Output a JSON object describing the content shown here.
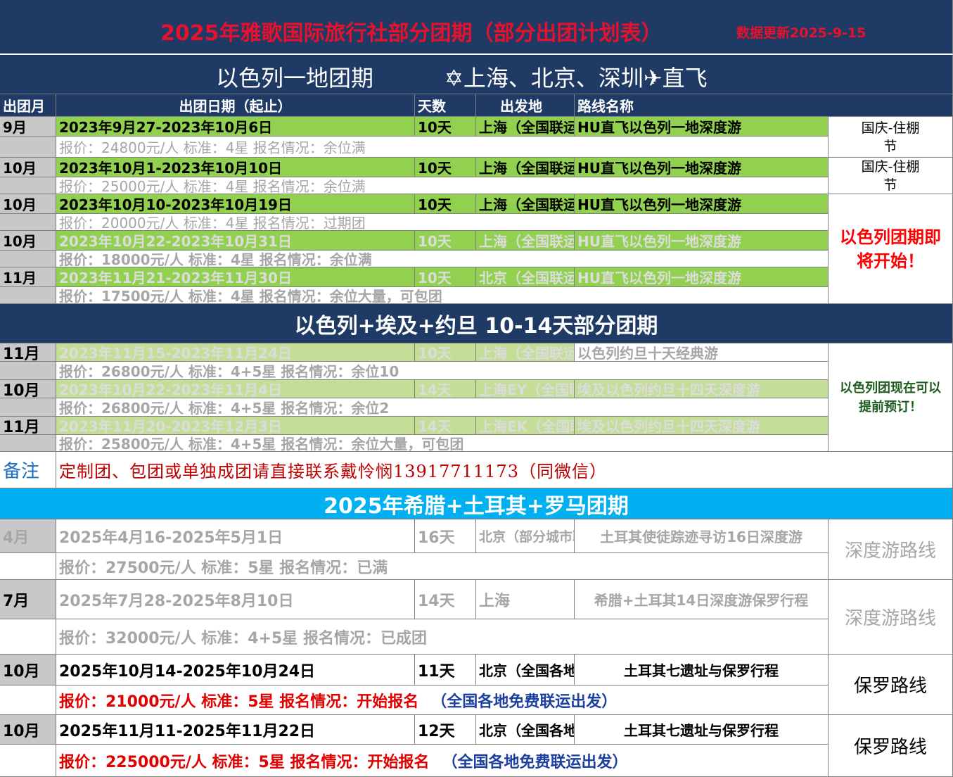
{
  "title": {
    "main": "2025年雅歌国际旅行社部分团期（部分出团计划表）",
    "updated": "数据更新2025-9-15"
  },
  "section1": {
    "title": "以色列一地团期",
    "route": "✡上海、北京、深圳✈直飞"
  },
  "headers": {
    "month": "出团月",
    "dates": "出团日期（起止）",
    "days": "天数",
    "from": "出发地",
    "route": "路线名称"
  },
  "israel_rows": [
    {
      "month": "9月",
      "dates": "2023年9月27-2023年10月6日",
      "days": "10天",
      "from": "上海（全国联运）",
      "route": "HU直飞以色列一地深度游",
      "price": "报价：24800元/人  标准：4星   报名情况：余位满"
    },
    {
      "month": "10月",
      "dates": "2023年10月1-2023年10月10日",
      "days": "10天",
      "from": "上海（全国联运）",
      "route": "HU直飞以色列一地深度游",
      "price": "报价：25000元/人  标准：4星   报名情况：余位满"
    },
    {
      "month": "10月",
      "dates": "2023年10月10-2023年10月19日",
      "days": "10天",
      "from": "上海（全国联运）",
      "route": "HU直飞以色列一地深度游",
      "price": "报价：20000元/人  标准：4星   报名情况：过期团"
    },
    {
      "month": "10月",
      "dates": "2023年10月22-2023年10月31日",
      "days": "10天",
      "from": "上海（全国联运）",
      "route": "HU直飞以色列一地深度游",
      "price": "报价：18000元/人  标准：4星   报名情况：余位满"
    },
    {
      "month": "11月",
      "dates": "2023年11月21-2023年11月30日",
      "days": "10天",
      "from": "北京（全国联运）",
      "route": "HU直飞以色列一地深度游",
      "price": "报价：17500元/人  标准：4星   报名情况：余位大量，可包团"
    }
  ],
  "israel_notes": {
    "note1": "国庆-住棚节",
    "note2": "国庆-住棚节",
    "note3": "以色列团期即将开始！"
  },
  "section2": {
    "title": "以色列+埃及+约旦 10-14天部分团期"
  },
  "combo_rows": [
    {
      "month": "11月",
      "dates": "2023年11月15-2023年11月24日",
      "days": "10天",
      "from": "上海（全国联运）",
      "route": "以色列约旦十天经典游",
      "price": "报价：26800元/人  标准：4+5星   报名情况：余位10"
    },
    {
      "month": "10月",
      "dates": "2023年10月22-2023年11月4日",
      "days": "14天",
      "from": "上海EY（全国联运）",
      "route": "埃及以色列约旦十四天深度游",
      "price": "报价：26800元/人  标准：4+5星   报名情况：余位2"
    },
    {
      "month": "11月",
      "dates": "2023年11月20-2023年12月3日",
      "days": "14天",
      "from": "上海EK（全国联运）",
      "route": "埃及以色列约旦十四天深度游",
      "price": "报价：25800元/人  标准：4+5星   报名情况：余位大量，可包团"
    }
  ],
  "combo_note": "以色列团现在可以提前预订！",
  "remark": {
    "label": "备注",
    "text": "定制团、包团或单独成团请直接联系戴怜悯13917711173（同微信）"
  },
  "section3": {
    "title": "2025年希腊+土耳其+罗马团期"
  },
  "greece_rows": [
    {
      "month": "4月",
      "dates": "2025年4月16-2025年5月1日",
      "days": "16天",
      "from": "北京（部分城市联运）",
      "route": "土耳其使徒踪迹寻访16日深度游",
      "price": "报价：27500元/人  标准：5星   报名情况：已满",
      "note": "深度游路线"
    },
    {
      "month": "7月",
      "dates": "2025年7月28-2025年8月10日",
      "days": "14天",
      "from": "上海",
      "route": "希腊+土耳其14日深度游保罗行程",
      "price": "报价：32000元/人  标准：4+5星   报名情况：已成团",
      "note": "深度游路线"
    },
    {
      "month": "10月",
      "dates": "2025年10月14-2025年10月24日",
      "days": "11天",
      "from": "北京（全国各地联运）",
      "route": "土耳其七遗址与保罗行程",
      "price": "报价：21000元/人  标准：5星   报名情况：开始报名",
      "price_extra": "（全国各地免费联运出发）",
      "note": "保罗路线"
    },
    {
      "month": "10月",
      "dates": "2025年11月11-2025年11月22日",
      "days": "12天",
      "from": "北京（全国各地联运）",
      "route": "土耳其七遗址与保罗行程",
      "price": "报价：225000元/人  标准：5星   报名情况：开始报名",
      "price_extra": "（全国各地免费联运出发）",
      "note": "保罗路线"
    }
  ],
  "colors": {
    "navy": "#1f3a64",
    "green": "#92d050",
    "cyan": "#00b0f0",
    "red": "#e00000",
    "blue": "#1c3fa0"
  }
}
